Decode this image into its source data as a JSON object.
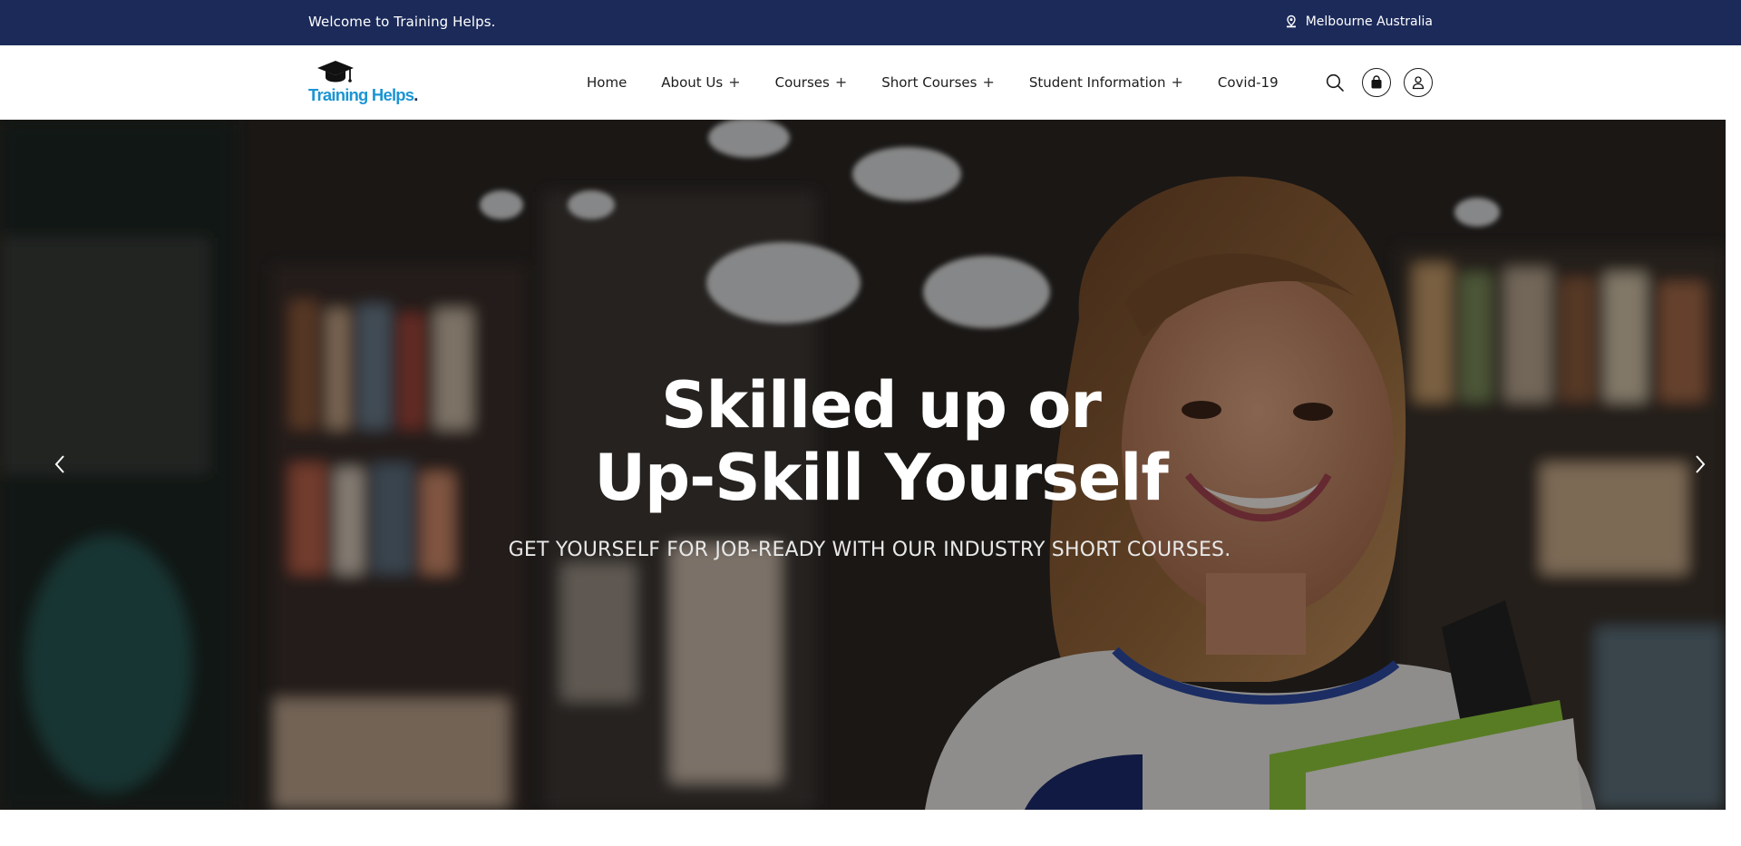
{
  "topbar": {
    "welcome": "Welcome to Training Helps.",
    "location": "Melbourne Australia",
    "location_icon": "location-pin-icon",
    "background": "#1b2a59"
  },
  "header": {
    "logo": {
      "text": "Training Helps",
      "dot": ".",
      "color": "#1c95d3"
    },
    "nav": [
      {
        "label": "Home",
        "expandable": false
      },
      {
        "label": "About Us",
        "expandable": true
      },
      {
        "label": "Courses",
        "expandable": true
      },
      {
        "label": "Short Courses",
        "expandable": true
      },
      {
        "label": "Student Information",
        "expandable": true
      },
      {
        "label": "Covid-19",
        "expandable": false
      }
    ],
    "expand_symbol": "+",
    "actions": [
      "search-icon",
      "shopping-bag-icon",
      "user-account-icon"
    ]
  },
  "hero": {
    "title_line1": "Skilled up or",
    "title_line2": "Up-Skill Yourself",
    "subtitle": "GET YOURSELF FOR JOB-READY WITH OUR INDUSTRY SHORT COURSES.",
    "prev_icon": "chevron-left-icon",
    "next_icon": "chevron-right-icon"
  }
}
